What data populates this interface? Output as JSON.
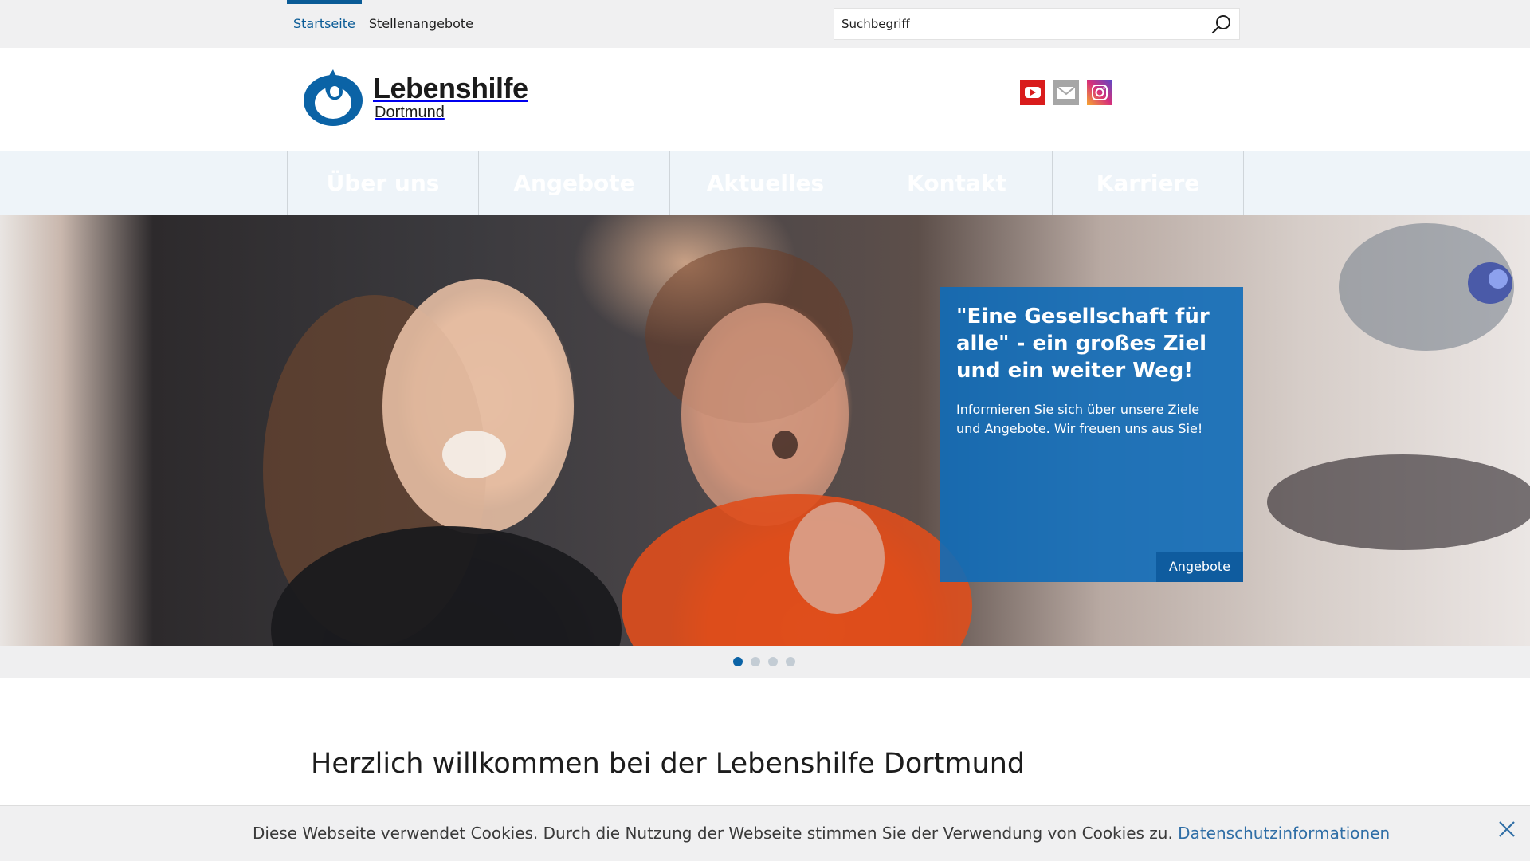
{
  "topnav": {
    "items": [
      {
        "label": "Startseite",
        "active": true
      },
      {
        "label": "Stellenangebote",
        "active": false
      }
    ]
  },
  "search": {
    "placeholder": "Suchbegriff",
    "icon": "search-icon"
  },
  "logo": {
    "name": "Lebenshilfe",
    "city": "Dortmund",
    "color": "#0b63a6"
  },
  "social": [
    {
      "name": "youtube-icon",
      "color": "#d91c1c"
    },
    {
      "name": "email-icon",
      "color": "#a6a6a6"
    },
    {
      "name": "instagram-icon",
      "color": "#9b36b7"
    }
  ],
  "mainnav": {
    "items": [
      "Über uns",
      "Angebote",
      "Aktuelles",
      "Kontakt",
      "Karriere"
    ]
  },
  "hero": {
    "title": "\"Eine Gesellschaft für alle\" - ein großes Ziel und ein weiter Weg!",
    "text": "Informieren Sie sich über unsere Ziele und Angebote. Wir freuen uns aus Sie!",
    "button": "Angebote",
    "card_color": "#106cb8"
  },
  "slider": {
    "count": 4,
    "active_index": 0
  },
  "content": {
    "heading": "Herzlich willkommen bei der Lebenshilfe Dortmund"
  },
  "cookie": {
    "text": "Diese Webseite verwendet Cookies. Durch die Nutzung der Webseite stimmen Sie der Verwendung von Cookies zu.",
    "link": "Datenschutzinformationen",
    "close_icon": "close-icon"
  }
}
